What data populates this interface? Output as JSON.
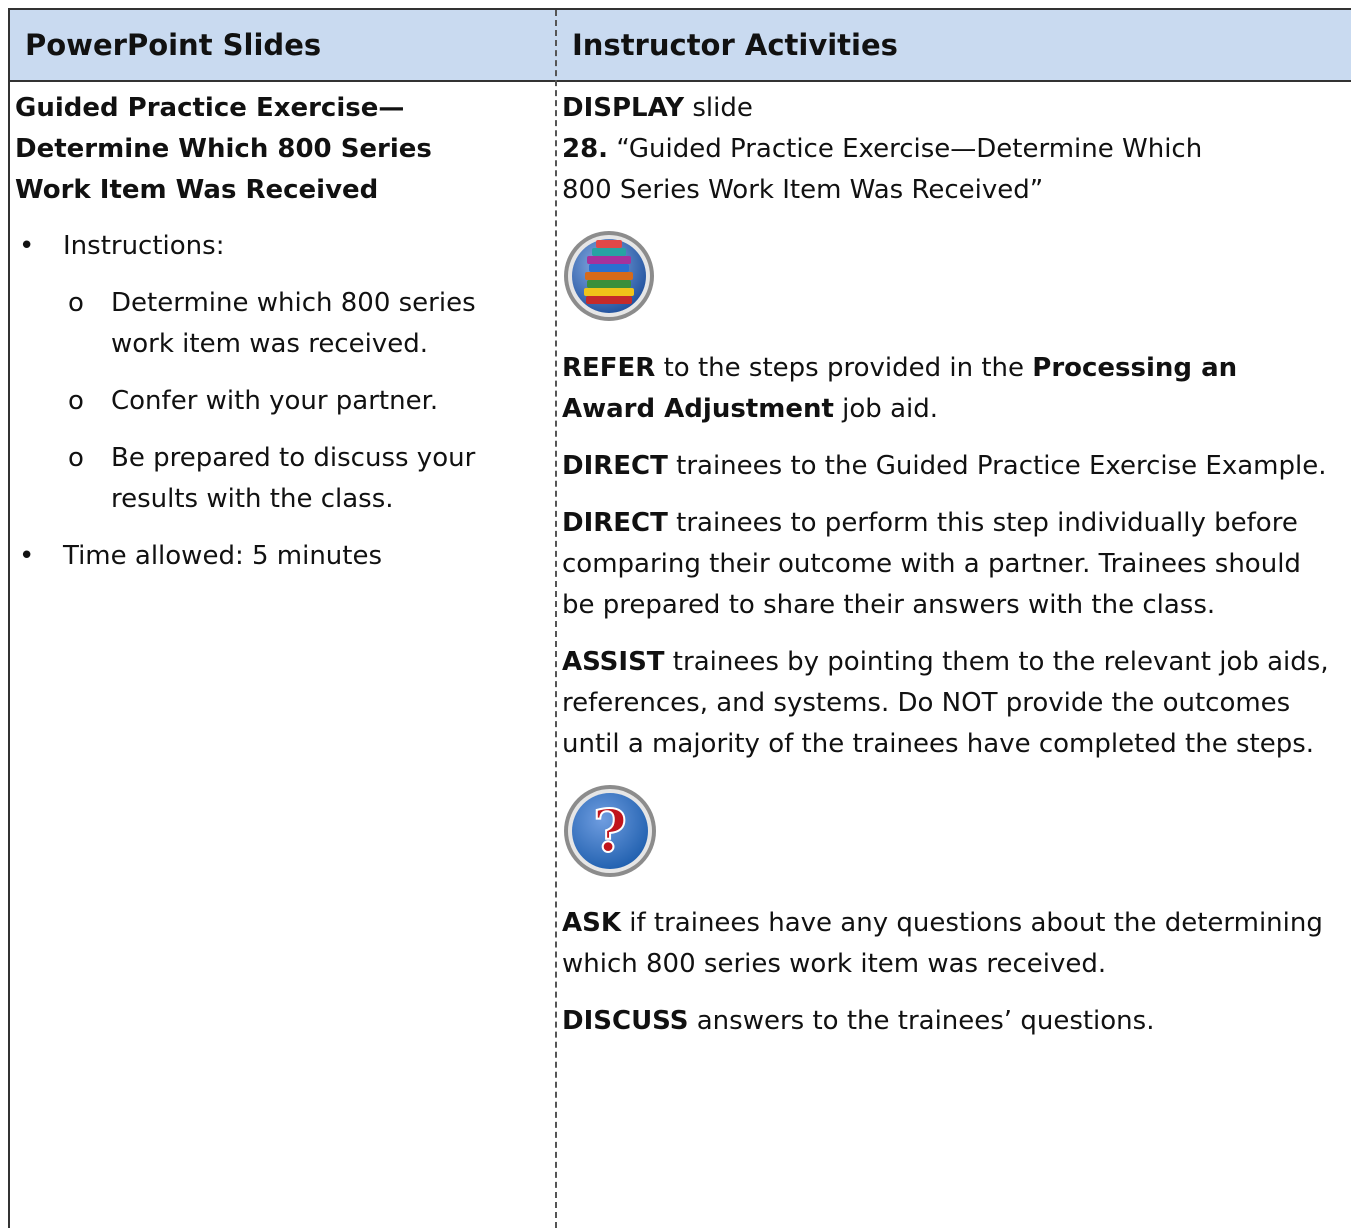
{
  "header": {
    "left": "PowerPoint Slides",
    "right": "Instructor Activities"
  },
  "slide": {
    "title_lines": [
      "Guided Practice Exercise—",
      "Determine Which 800 Series",
      "Work Item Was Received"
    ],
    "bullets": {
      "instructions": "Instructions:",
      "sub": [
        {
          "marker": "o",
          "lines": [
            "Determine which 800 series",
            "work item was received."
          ]
        },
        {
          "marker": "o",
          "lines": [
            "Confer with your partner."
          ]
        },
        {
          "marker": "o",
          "lines": [
            "Be prepared to discuss your",
            "results with the class."
          ]
        }
      ],
      "time": "Time allowed: 5 minutes",
      "bullet_char": "•"
    }
  },
  "activities": {
    "display_kw": "DISPLAY",
    "display_rest": " slide",
    "slide_num": "28.",
    "slide_title_line1": " “Guided Practice Exercise—Determine Which",
    "slide_title_line2": "800 Series Work Item Was Received”",
    "icon1": "books-stack-icon",
    "refer_kw": "REFER",
    "refer_mid": " to the steps provided in the ",
    "refer_bold": "Processing an Award Adjustment",
    "refer_end": " job aid.",
    "direct1_kw": "DIRECT",
    "direct1_rest": " trainees to the Guided Practice Exercise Example.",
    "direct2_kw": "DIRECT",
    "direct2_rest": " trainees to perform this step individually before comparing their outcome with a partner. Trainees should be prepared to share their answers with the class.",
    "assist_kw": "ASSIST",
    "assist_rest": " trainees by pointing them to the relevant job aids, references, and systems. Do NOT provide the outcomes until a majority of the trainees have completed the steps.",
    "icon2": "question-mark-icon",
    "icon2_glyph": "?",
    "ask_kw": "ASK",
    "ask_rest": " if trainees have any questions about the determining which 800 series work item was received.",
    "discuss_kw": "DISCUSS",
    "discuss_rest": " answers to the trainees’ questions.",
    "colors": {
      "header_bg": "#c9daf0",
      "question_icon_blue": "#1f5fae",
      "question_mark_red": "#c0141c"
    }
  }
}
